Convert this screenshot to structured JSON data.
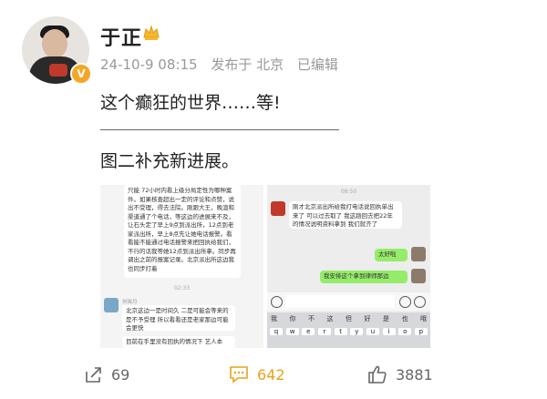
{
  "author": {
    "name": "于正",
    "verified_badge": "V"
  },
  "post": {
    "date": "24-10-9 08:15",
    "location": "发布于 北京",
    "edited": "已编辑",
    "text_line1": "这个癫狂的世界……等!",
    "text_line2": "图二补充新进展。"
  },
  "screenshot1": {
    "msg1": "只能 72小时内看上级分局定性为哪种案件。如果核查超出一定的评论和点赞，说出不受理，得去法院。刚跟大王，晚渲和渠道通了个电话，等这边的进展来不及，让石头定了早上9点到派出所，12点到老家派出所，早上8点先让她电话报警。看看能不能通过电话报警来把回执给我们，不行的话我等她12点到派出所拿。同步再调出之前的报案记录。北京派出所这边我也同步打着",
    "time": "02:33",
    "sender": "刘晓月",
    "msg2": "北京这边一是时间久 二是可能会等来的是不予受理 所以看看还是老家那边可能会更快",
    "msg3": "目前在手里没有回执的情况下 艺人本"
  },
  "screenshot2": {
    "time": "08:50",
    "msg1": "刚才北京派出所给我打电话说回执单出来了 可以过去取了 我这趟回去把22年的情况说明资料拿到 我们就齐了",
    "msg2": "太好啦",
    "msg3": "我安排这个拿到律师那边",
    "keyboard_row1": [
      "我",
      "你",
      "不",
      "这",
      "但",
      "好",
      "是",
      "也",
      "哦"
    ],
    "keyboard_row2": [
      "q",
      "w",
      "e",
      "r",
      "t",
      "y",
      "u",
      "i",
      "o",
      "p"
    ]
  },
  "actions": {
    "share_count": "69",
    "comment_count": "642",
    "like_count": "3881"
  },
  "colors": {
    "accent": "#f5a623",
    "comment_count": "#e8a317",
    "wechat_green": "#95ec69"
  }
}
